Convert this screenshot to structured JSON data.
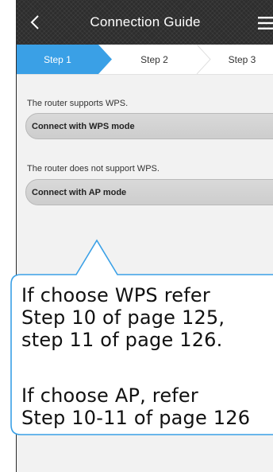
{
  "header": {
    "title": "Connection Guide",
    "back_icon": "chevron-left-icon",
    "menu_icon": "hamburger-menu-icon"
  },
  "steps": {
    "active_index": 0,
    "items": [
      {
        "label": "Step 1"
      },
      {
        "label": "Step 2"
      },
      {
        "label": "Step 3"
      }
    ],
    "active_color": "#3aa0e6"
  },
  "options": [
    {
      "description": "The router supports WPS.",
      "button_label": "Connect with WPS mode"
    },
    {
      "description": "The router does not support WPS.",
      "button_label": "Connect with AP mode"
    }
  ],
  "callout": {
    "lines": [
      "If choose WPS refer",
      "Step 10 of page 125,",
      "step 11 of page 126.",
      "If choose AP, refer",
      "Step 10-11 of page 126"
    ],
    "border_color": "#3aa0e6"
  }
}
